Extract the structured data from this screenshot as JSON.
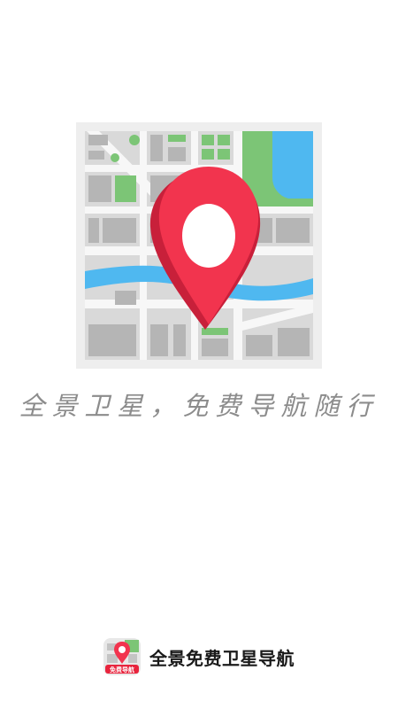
{
  "splash": {
    "slogan": "全景卫星，免费导航随行",
    "app_name": "全景免费卫星导航",
    "app_icon_label": "免费导航",
    "hero_icon": "map-pin-icon",
    "colors": {
      "pin": "#f2344e",
      "pin_shade": "#c8203a",
      "park": "#7cc576",
      "water": "#4fb8f0",
      "block": "#b5b5b5",
      "road": "#f5f5f5",
      "slogan": "#8c8c8c"
    }
  }
}
